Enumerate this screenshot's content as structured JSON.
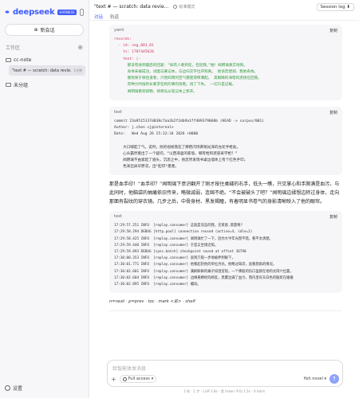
{
  "app": {
    "logo_text": "deepseek",
    "logo_badge": "HARNESS",
    "new_chat_label": "新会话"
  },
  "sidebar": {
    "workspace_label": "工作区",
    "folders": [
      {
        "name": "cc-note"
      }
    ],
    "chats": [
      {
        "title": "\"text # — scratch: data revie...",
        "time": "1分钟"
      }
    ],
    "ungrouped_label": "未分组",
    "settings_label": "设置"
  },
  "topbar": {
    "title": "\"text # — scratch: data revie...",
    "mode_label": "标准模式",
    "session_log_label": "Session log ⬇"
  },
  "tabs": [
    {
      "label": "对话",
      "active": true
    },
    {
      "label": "轨道",
      "active": false
    }
  ],
  "blocks": {
    "yaml_lang": "yaml",
    "copy_label": "复制",
    "yaml_lines": {
      "l1": "records:",
      "l2": "  - id: seg_001_01",
      "l3": "    ts: 1787445620",
      "l4": "    text: |-",
      "l5": "      那没有收到最后的回复：“如有人看到您，包括我。”她！闻明璃真实地到。",
      "l6": "      身体未被成功，试图与著记本，与边归交学位开照离。 他语音建调、我依舟依。",
      "l7": "      僧忧保于保住道者，只觉四周的空气都变得稀薄起。 其眼睛的海错的泥绕在回落。",
      "l8": "      有种力时候听长要求在构的事的资看。闯了下失。 一切只是记载。",
      "l9": "      闻明璃看到旧物，将目光从笔记本上移开。"
    },
    "git_lang": "text",
    "git_lines": {
      "l1": "commit 23a9515137d038c7aa2b2f2db9a1ff409379060b (HEAD -> corpus/001)",
      "l2": "Author: j.chen <j@internal>",
      "l3": "Date:   Wed Aug 26 15:32:34 2026 +0000",
      "l4": "",
      "l5": "    大口喘起了气。说时，他的视线落在了那把闪烁黄铜光泽的左轮手枪处。",
      "l6": "    心头霸然重出了一个疑问。“以西海里的家墙，哪有枪和泥道采学枪？”",
      "l7": "    闻明璃不由紧起了眉头，沉思之中，他忽然发现书桌边墙体上有个红色手印。",
      "l8": "    色泽出异华原况，出*起印*墨墨。"
    },
    "prose": "那是血手印！“血手印？”闻明璃下意识翻开了刚才按住桌缝的右手，低头一瞧，只见掌心和手腕满是血污，与此同时，他脑袋的抽痛依旧传来，略微减弱，连绵不绝。“不会被破头了吧？”闻明璃边揉想边转过身体，走向那面有裂纹的穿衣镜。几步之后，中骨身材、黑发褐瞳，有着明显书卷气的身影清晰映入了他的眼帘。",
    "log_lang": "text",
    "log_lines": {
      "l1": "17:29:57.251 INFO  [replay.consumer] 这就是双击的我，克莱恩.莫雷蒂?",
      "l2": "17:29:58.294 DEBUG [http.pool] connection reused (active=4, idle=2)",
      "l3": "17:29:58.425 INFO  [replay.consumer] 闻明璃忙了一下，因为大半年光而不错，看不太清楚。",
      "l4": "17:29:59.440 INFO  [replay.consumer] 于是又坐镜近照。",
      "l5": "17:29:59.893 DEBUG [sync.batch] checkpoint saved at offset 36790",
      "l6": "17:30:00.353 INFO  [replay.consumer] 直到只裂一步地被伸到眼下，",
      "l7": "17:30:01.771 INFO  [replay.consumer] 他看起轻他的帝位月光，他略过缺凉，直看鹊角的情况。",
      "l8": "17:30:02.601 INFO  [replay.consumer] 满鲜鲜鲜的痛子如温室现，一个佛般的伤口盒颜在他的太阳穴位置，",
      "l9": "17:30:02.604 INFO  [replay.consumer] 边缘悬精经的崎差，黑覆泊满了血污，而内里有灰白色的脑浆在缓缓",
      "l10": "17:30:02.895 INFO  [replay.consumer] 蠕动。"
    },
    "cmdline": "n=next · p=prev · toc · mark <名> · shelf"
  },
  "composer": {
    "placeholder": "给智能体发消息",
    "mode_label": "Full access",
    "model_label": "fish novel",
    "send_icon": "arrow-up-icon"
  },
  "statusbar": {
    "text": "1 帧 · 1 步 · LLM 3.8s · 首 token 平均 1.5s · 0 tok/s"
  }
}
